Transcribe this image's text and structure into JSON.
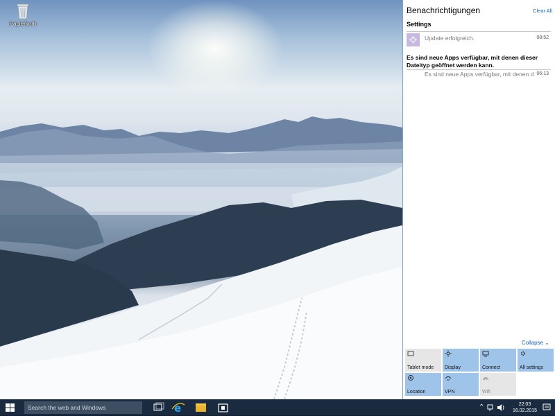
{
  "desktop": {
    "icons": [
      {
        "label": "Papierkorb",
        "icon": "recycle-bin-icon"
      }
    ]
  },
  "action_center": {
    "title": "Benachrichtigungen",
    "clear_all": "Clear All",
    "groups": [
      {
        "title": "Settings",
        "notifications": [
          {
            "text": "Update erfolgreich.",
            "time": "08:52",
            "icon": "settings-gear-icon"
          }
        ]
      }
    ],
    "message_bold": "Es sind neue Apps verfügbar, mit denen dieser Dateityp geöffnet werden kann.",
    "message_row": {
      "text": "Es sind neue Apps verfügbar, mit denen d",
      "time": "06:13"
    },
    "collapse_label": "Collapse",
    "quick_actions": [
      {
        "label": "Tablet mode",
        "state": "off",
        "icon": "tablet-mode-icon"
      },
      {
        "label": "Display",
        "state": "on",
        "icon": "brightness-icon"
      },
      {
        "label": "Connect",
        "state": "on",
        "icon": "connect-icon"
      },
      {
        "label": "All settings",
        "state": "on",
        "icon": "settings-gear-icon"
      },
      {
        "label": "Location",
        "state": "on",
        "icon": "location-icon"
      },
      {
        "label": "VPN",
        "state": "on",
        "icon": "vpn-icon"
      },
      {
        "label": "Wifi",
        "state": "off",
        "icon": "wifi-icon"
      }
    ]
  },
  "taskbar": {
    "search_placeholder": "Search the web and Windows",
    "apps": [
      "task-view-icon",
      "internet-explorer-icon",
      "file-explorer-icon",
      "store-icon"
    ],
    "clock": {
      "time": "22:03",
      "date": "16.02.2015"
    }
  },
  "colors": {
    "accent": "#9fc4ea",
    "link": "#1a64c8",
    "taskbar": "#1b2b3f",
    "notification_icon_bg": "#c7b7e3"
  }
}
